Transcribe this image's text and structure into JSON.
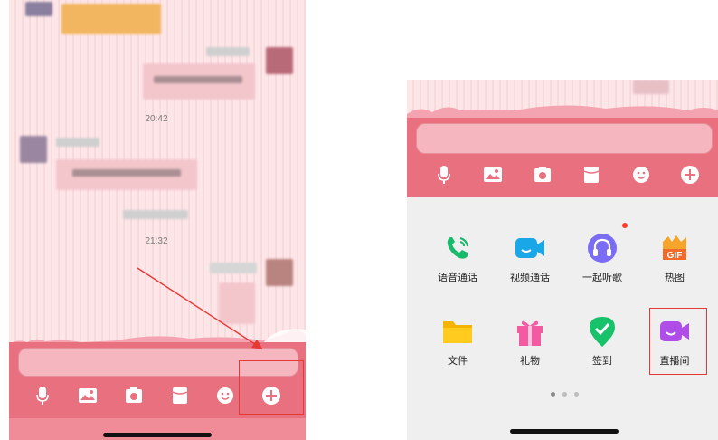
{
  "left_chat": {
    "timestamps": [
      "20:42",
      "21:32"
    ]
  },
  "toolbar": {
    "icons": [
      "microphone-icon",
      "photo-icon",
      "camera-icon",
      "red-packet-icon",
      "emoji-icon",
      "plus-icon"
    ]
  },
  "panel": {
    "apps": [
      {
        "label": "语音通话",
        "icon": "voice-call-icon",
        "color": "#17b96b"
      },
      {
        "label": "视频通话",
        "icon": "video-call-icon",
        "color": "#1aa7e8"
      },
      {
        "label": "一起听歌",
        "icon": "headphones-icon",
        "color": "#7b6cf6",
        "badge": true
      },
      {
        "label": "热图",
        "icon": "gif-icon",
        "color": "#f5a52b"
      },
      {
        "label": "文件",
        "icon": "folder-icon",
        "color": "#f5b400"
      },
      {
        "label": "礼物",
        "icon": "gift-icon",
        "color": "#f25aa2"
      },
      {
        "label": "签到",
        "icon": "checkin-icon",
        "color": "#18c26a"
      },
      {
        "label": "直播间",
        "icon": "live-room-icon",
        "color": "#b04ce8"
      }
    ],
    "page_dots": 3,
    "active_page": 1
  },
  "colors": {
    "toolbar_pink": "#e9707f",
    "highlight_red": "#e53935",
    "badge_red": "#ff3b30"
  }
}
